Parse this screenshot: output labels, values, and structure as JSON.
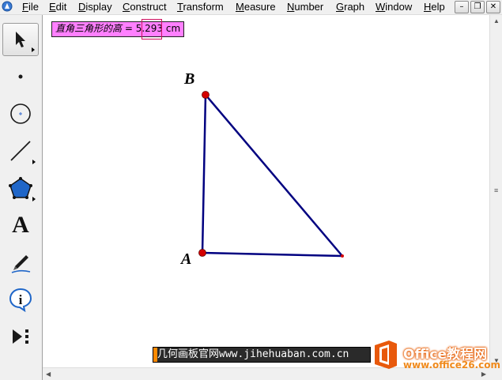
{
  "menubar": {
    "items": [
      {
        "label": "File",
        "u": "F",
        "rest": "ile"
      },
      {
        "label": "Edit",
        "u": "E",
        "rest": "dit"
      },
      {
        "label": "Display",
        "u": "D",
        "rest": "isplay"
      },
      {
        "label": "Construct",
        "u": "C",
        "rest": "onstruct"
      },
      {
        "label": "Transform",
        "u": "T",
        "rest": "ransform"
      },
      {
        "label": "Measure",
        "u": "M",
        "rest": "easure"
      },
      {
        "label": "Number",
        "u": "N",
        "rest": "umber"
      },
      {
        "label": "Graph",
        "u": "G",
        "rest": "raph"
      },
      {
        "label": "Window",
        "u": "W",
        "rest": "indow"
      },
      {
        "label": "Help",
        "u": "H",
        "rest": "elp"
      }
    ],
    "window_controls": {
      "minimize": "–",
      "restore": "❐",
      "close": "✕"
    }
  },
  "toolbox": {
    "tools": [
      {
        "name": "arrow-tool",
        "icon": "arrow-icon",
        "selected": true
      },
      {
        "name": "point-tool",
        "icon": "point-icon"
      },
      {
        "name": "compass-tool",
        "icon": "compass-icon"
      },
      {
        "name": "straightedge-tool",
        "icon": "line-icon"
      },
      {
        "name": "polygon-tool",
        "icon": "pentagon-icon"
      },
      {
        "name": "text-tool",
        "icon": "text-A-icon"
      },
      {
        "name": "marker-tool",
        "icon": "pen-icon"
      },
      {
        "name": "information-tool",
        "icon": "info-icon"
      },
      {
        "name": "custom-tool",
        "icon": "play-dots-icon"
      }
    ],
    "text_tool_glyph": "A"
  },
  "measurement": {
    "label": "直角三角形的高 = ",
    "value_a": "5",
    "value_b": ".293",
    "unit": " cm"
  },
  "points": {
    "A": "A",
    "B": "B"
  },
  "watermark": {
    "banner": "几何画板官网www.jihehuaban.com.cn",
    "brand": "Office教程网",
    "url": "www.office26.com"
  },
  "colors": {
    "segment": "#000080",
    "point": "#d40000",
    "measure_bg": "#ff80ff"
  }
}
